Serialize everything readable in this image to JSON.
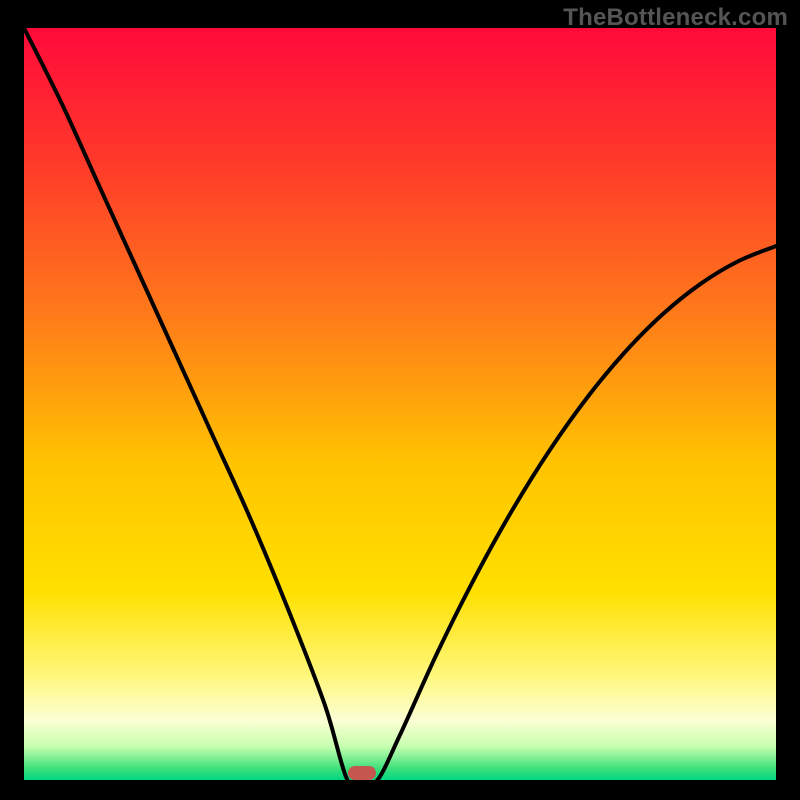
{
  "watermark": "TheBottleneck.com",
  "chart_data": {
    "type": "line",
    "title": "",
    "xlabel": "",
    "ylabel": "",
    "x": [
      0.0,
      0.05,
      0.1,
      0.15,
      0.2,
      0.25,
      0.3,
      0.35,
      0.4,
      0.43,
      0.45,
      0.47,
      0.5,
      0.55,
      0.6,
      0.65,
      0.7,
      0.75,
      0.8,
      0.85,
      0.9,
      0.95,
      1.0
    ],
    "values": [
      1.0,
      0.9,
      0.79,
      0.68,
      0.57,
      0.46,
      0.35,
      0.23,
      0.1,
      0.0,
      0.0,
      0.0,
      0.06,
      0.17,
      0.27,
      0.36,
      0.44,
      0.51,
      0.57,
      0.62,
      0.66,
      0.69,
      0.71
    ],
    "xlim": [
      0,
      1
    ],
    "ylim": [
      0,
      1
    ],
    "dip_center_x": 0.45,
    "marker_color": "#c6574e",
    "gradient_stops": [
      {
        "offset": 0.0,
        "color": "#ff0a3a"
      },
      {
        "offset": 0.18,
        "color": "#ff3a2a"
      },
      {
        "offset": 0.38,
        "color": "#ff7a1a"
      },
      {
        "offset": 0.58,
        "color": "#ffc400"
      },
      {
        "offset": 0.75,
        "color": "#ffe000"
      },
      {
        "offset": 0.86,
        "color": "#fff77a"
      },
      {
        "offset": 0.92,
        "color": "#fcffd4"
      },
      {
        "offset": 0.955,
        "color": "#c8ffb0"
      },
      {
        "offset": 0.985,
        "color": "#3de07a"
      },
      {
        "offset": 1.0,
        "color": "#00d780"
      }
    ]
  }
}
